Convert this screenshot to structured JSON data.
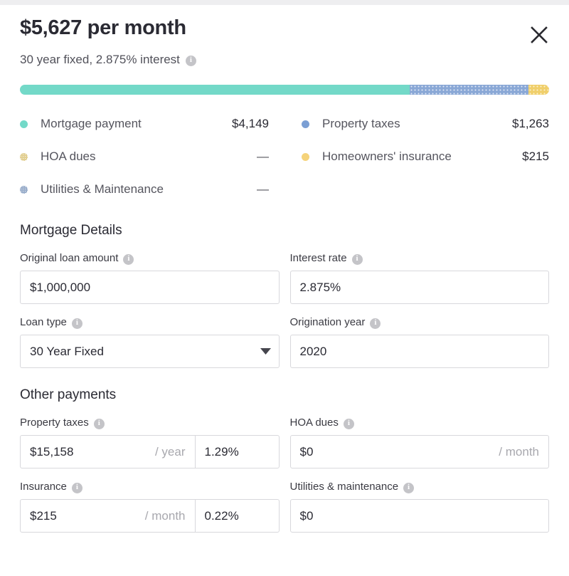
{
  "header": {
    "headline": "$5,627 per month",
    "subtitle": "30 year fixed, 2.875% interest",
    "info_glyph": "i",
    "close_label": "×"
  },
  "colors": {
    "mortgage": "#73d9c8",
    "property_taxes": "#8aa8d6",
    "hoa": "#e2cf92",
    "insurance": "#f5d37a",
    "utilities": "#9aaecb",
    "bar_track": "#e8e8ea"
  },
  "breakdown_bar": {
    "segments": [
      {
        "name": "mortgage-payment",
        "pct": 73.7,
        "color": "#73d9c8",
        "pattern": "solid"
      },
      {
        "name": "property-taxes",
        "pct": 22.4,
        "color": "#8aa8d6",
        "pattern": "dots"
      },
      {
        "name": "homeowners-insurance",
        "pct": 3.9,
        "color": "#f0cf6b",
        "pattern": "dots"
      }
    ]
  },
  "legend": {
    "left": [
      {
        "label": "Mortgage payment",
        "value": "$4,149",
        "color": "#73d9c8",
        "pattern": "solid"
      },
      {
        "label": "HOA dues",
        "value": "—",
        "color": "#e2cf92",
        "pattern": "dotted"
      },
      {
        "label": "Utilities & Maintenance",
        "value": "—",
        "color": "#9aaecb",
        "pattern": "dotted"
      }
    ],
    "right": [
      {
        "label": "Property taxes",
        "value": "$1,263",
        "color": "#7b9fd4",
        "pattern": "solid"
      },
      {
        "label": "Homeowners' insurance",
        "value": "$215",
        "color": "#f5d37a",
        "pattern": "solid"
      }
    ]
  },
  "mortgage_details": {
    "title": "Mortgage Details",
    "original_loan_amount": {
      "label": "Original loan amount",
      "value": "$1,000,000"
    },
    "interest_rate": {
      "label": "Interest rate",
      "value": "2.875%"
    },
    "loan_type": {
      "label": "Loan type",
      "value": "30 Year Fixed"
    },
    "origination_year": {
      "label": "Origination year",
      "value": "2020"
    }
  },
  "other_payments": {
    "title": "Other payments",
    "property_taxes": {
      "label": "Property taxes",
      "value": "$15,158",
      "suffix": "/ year",
      "rate": "1.29%"
    },
    "hoa_dues": {
      "label": "HOA dues",
      "value": "$0",
      "suffix": "/ month"
    },
    "insurance": {
      "label": "Insurance",
      "value": "$215",
      "suffix": "/ month",
      "rate": "0.22%"
    },
    "utilities_maintenance": {
      "label": "Utilities & maintenance",
      "value": "$0"
    }
  }
}
